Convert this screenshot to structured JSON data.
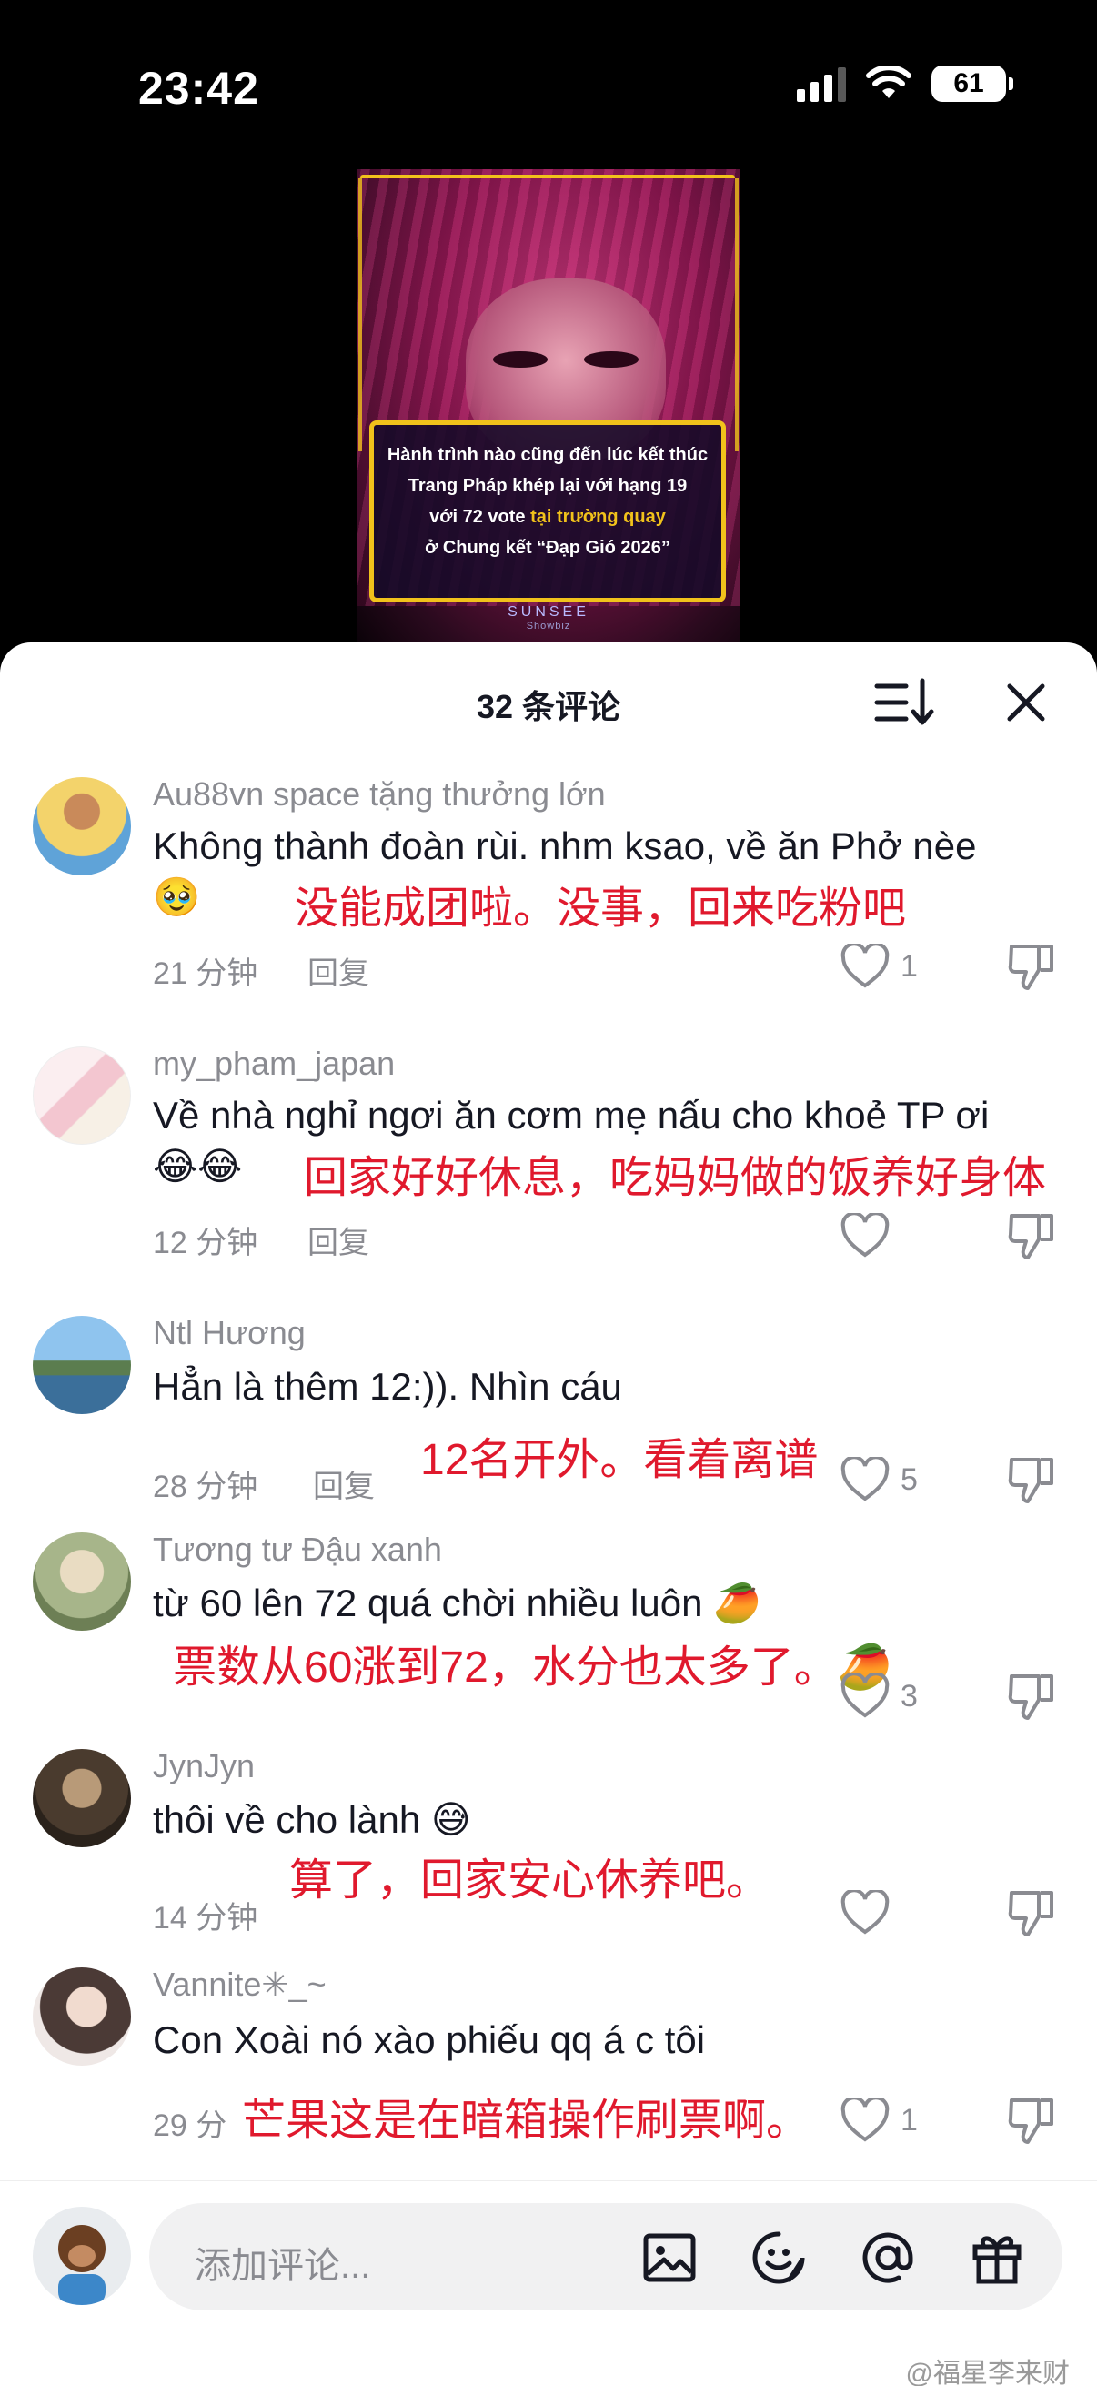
{
  "status": {
    "time": "23:42",
    "battery": "61"
  },
  "video": {
    "caption_lines": [
      {
        "text": "Hành trình nào cũng đến lúc kết thúc",
        "highlight": ""
      },
      {
        "text": "Trang Pháp khép lại với hạng 19",
        "highlight": ""
      },
      {
        "pre": "với 72 vote ",
        "highlight": "tại trường quay",
        "post": ""
      },
      {
        "text": "ở Chung kết “Đạp Gió 2026”",
        "highlight": ""
      }
    ],
    "brand": "SUNSEE",
    "brand_sub": "Showbiz"
  },
  "sheet": {
    "title": "32 条评论"
  },
  "comments": [
    {
      "user": "Au88vn space tặng thưởng lớn",
      "text": "Không thành đoàn rùi. nhm ksao, về ăn Phở nèe🥹",
      "translation": "没能成团啦。没事，回来吃粉吧",
      "time": "21 分钟",
      "reply": "回复",
      "likes": "1"
    },
    {
      "user": "my_pham_japan",
      "text": "Về nhà nghỉ ngơi ăn cơm mẹ nấu cho khoẻ TP ơi 😂😂",
      "translation": "回家好好休息，吃妈妈做的饭养好身体",
      "time": "12 分钟",
      "reply": "回复",
      "likes": ""
    },
    {
      "user": "Ntl Hương",
      "text": "Hẳn là thêm 12:)). Nhìn cáu",
      "translation": "12名开外。看着离谱",
      "time": "28 分钟",
      "reply": "回复",
      "likes": "5"
    },
    {
      "user": "Tương tư Đậu xanh",
      "text": "từ 60 lên 72 quá chời nhiều luôn 🥭",
      "translation": "票数从60涨到72，水分也太多了。🥭",
      "time": "",
      "reply": "",
      "likes": "3"
    },
    {
      "user": "JynJyn",
      "text": "thôi về cho lành 😅",
      "translation": "算了，回家安心休养吧。",
      "time": "14 分钟",
      "reply": "",
      "likes": ""
    },
    {
      "user": "Vannite✳︎_~",
      "text": "Con Xoài nó xào phiếu qq á c tôi",
      "translation": "芒果这是在暗箱操作刷票啊。",
      "time": "29 分",
      "reply": "",
      "likes": "1"
    }
  ],
  "input": {
    "placeholder": "添加评论..."
  },
  "watermark": "@福星李来财",
  "icons": [
    "sort-icon",
    "close-icon",
    "heart-icon",
    "dislike-icon",
    "image-icon",
    "emoji-icon",
    "mention-icon",
    "gift-icon"
  ],
  "colors": {
    "translation_red": "#e0192d",
    "meta_gray": "#8a8b91",
    "text_dark": "#161823"
  }
}
